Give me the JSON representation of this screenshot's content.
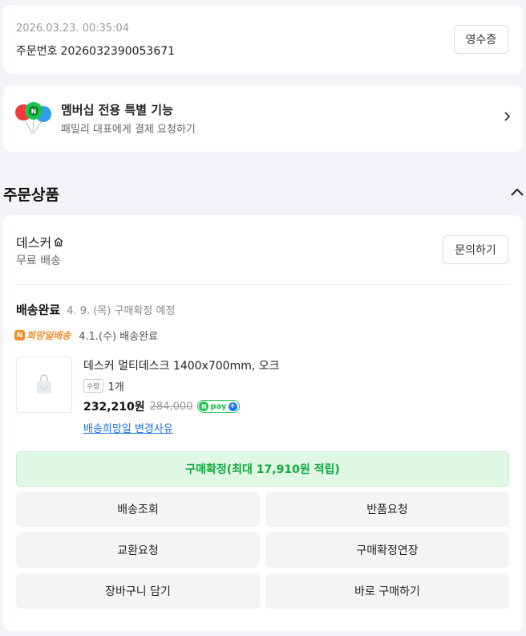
{
  "order": {
    "datetime": "2026.03.23. 00:35:04",
    "number_label": "주문번호",
    "number": "2026032390053671",
    "receipt_label": "영수증"
  },
  "membership": {
    "title": "멤버십 전용 특별 기능",
    "subtitle": "패밀리 대표에게 결제 요청하기"
  },
  "section": {
    "title": "주문상품"
  },
  "store": {
    "name": "데스커",
    "shipping": "무료 배송",
    "inquiry_label": "문의하기"
  },
  "delivery": {
    "status": "배송완료",
    "status_detail": "4. 9. (목) 구매확정 예정",
    "hope_badge": "희망일배송",
    "hope_detail": "4.1.(수) 배송완료"
  },
  "product": {
    "name": "데스커 멀티데스크 1400x700mm, 오크",
    "qty_label": "수량",
    "qty": "1개",
    "price": "232,210원",
    "original_price": "284,000",
    "npay_label": "pay",
    "change_reason_link": "배송희망일 변경사유"
  },
  "actions": {
    "confirm": "구매확정(최대 17,910원 적립)",
    "track": "배송조회",
    "return": "반품요청",
    "exchange": "교환요청",
    "extend": "구매확정연장",
    "cart": "장바구니 담기",
    "buy_now": "바로 구매하기"
  },
  "colors": {
    "accent_green": "#11a83e",
    "confirm_bg": "#dff7e3",
    "hope_orange": "#f08c2e",
    "link_blue": "#1a73e8"
  }
}
